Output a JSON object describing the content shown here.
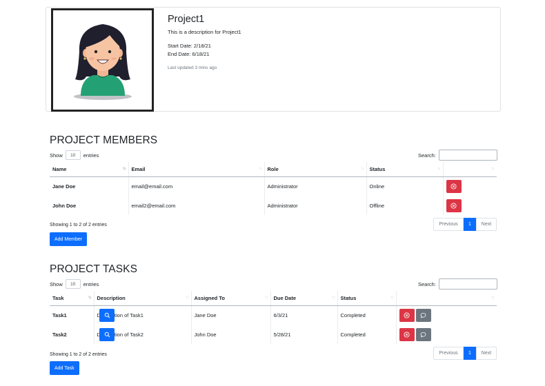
{
  "project": {
    "title": "Project1",
    "description": "This is a description for Project1",
    "start_date": "Start Date: 2/18/21",
    "end_date": "End Date: 6/18/21",
    "updated": "Last updated 3 mins ago"
  },
  "members": {
    "heading": "PROJECT MEMBERS",
    "show_label": "Show",
    "length_value": "10",
    "entries_label": "entries",
    "search_label": "Search:",
    "columns": [
      "Name",
      "Email",
      "Role",
      "Status"
    ],
    "rows": [
      {
        "name": "Jane Doe",
        "email": "email@email.com",
        "role": "Administrator",
        "status": "Online"
      },
      {
        "name": "John Doe",
        "email": "email2@email.com",
        "role": "Administrator",
        "status": "Offline"
      }
    ],
    "info": "Showing 1 to 2 of 2 entries",
    "prev": "Previous",
    "page": "1",
    "next": "Next",
    "add_button": "Add Member"
  },
  "tasks": {
    "heading": "PROJECT TASKS",
    "show_label": "Show",
    "length_value": "10",
    "entries_label": "entries",
    "search_label": "Search:",
    "columns": [
      "Task",
      "Description",
      "Assigned To",
      "Due Date",
      "Status"
    ],
    "rows": [
      {
        "task": "Task1",
        "description": "Description of Task1",
        "assigned": "Jane Doe",
        "due": "6/3/21",
        "status": "Completed"
      },
      {
        "task": "Task2",
        "description": "Description of Task2",
        "assigned": "John Doe",
        "due": "5/28/21",
        "status": "Completed"
      }
    ],
    "info": "Showing 1 to 2 of 2 entries",
    "prev": "Previous",
    "page": "1",
    "next": "Next",
    "add_button": "Add Task"
  },
  "colors": {
    "primary": "#0d6efd",
    "danger": "#dc3545",
    "secondary": "#6c757d"
  }
}
